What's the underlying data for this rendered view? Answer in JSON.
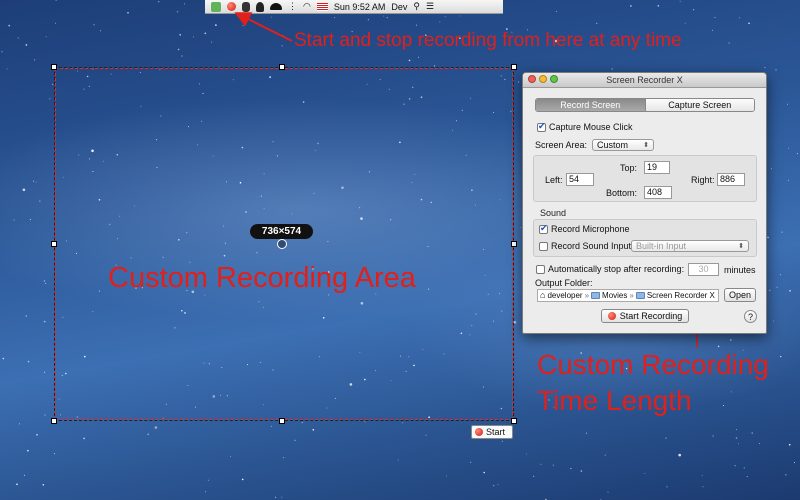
{
  "menubar": {
    "clock": "Sun 9:52 AM",
    "user": "Dev",
    "icons": [
      "app-icon",
      "record-icon",
      "evernote-icon",
      "alfred-icon",
      "hat-icon",
      "bluetooth-icon",
      "wifi-icon",
      "flag-icon",
      "search-icon",
      "list-icon"
    ]
  },
  "annotations": {
    "menubar_note": "Start and stop recording from here at any time",
    "area_note": "Custom Recording Area",
    "time_note_line1": "Custom Recording",
    "time_note_line2": "Time Length",
    "color": "#e0201a"
  },
  "selection": {
    "size_label": "736×574",
    "start_label": "Start"
  },
  "window": {
    "title": "Screen Recorder X",
    "tabs": [
      {
        "label": "Record Screen",
        "active": true
      },
      {
        "label": "Capture Screen",
        "active": false
      }
    ],
    "capture_mouse_click": {
      "label": "Capture Mouse Click",
      "checked": true
    },
    "screen_area": {
      "label": "Screen Area:",
      "value": "Custom"
    },
    "coords": {
      "top_label": "Top:",
      "top_value": "19",
      "left_label": "Left:",
      "left_value": "54",
      "right_label": "Right:",
      "right_value": "886",
      "bottom_label": "Bottom:",
      "bottom_value": "408"
    },
    "sound": {
      "section_label": "Sound",
      "record_microphone": {
        "label": "Record Microphone",
        "checked": true
      },
      "record_sound_input": {
        "label": "Record Sound Input",
        "checked": false
      },
      "input_select": "Built-in Input"
    },
    "auto_stop": {
      "label": "Automatically stop after recording:",
      "value": "30",
      "unit": "minutes",
      "checked": false
    },
    "output": {
      "label": "Output Folder:",
      "path": [
        "developer",
        "Movies",
        "Screen Recorder X"
      ],
      "path_sep": "»",
      "open_label": "Open"
    },
    "start_button": "Start Recording",
    "help_label": "?"
  }
}
